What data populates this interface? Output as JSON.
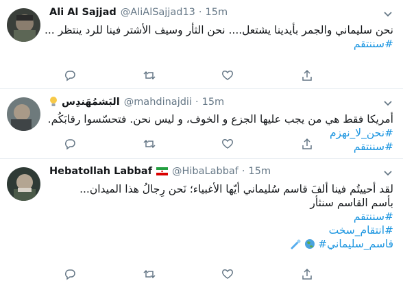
{
  "tweets": [
    {
      "name": "Ali Al Sajjad",
      "handle": "@AliAlSajjad13",
      "separator": "·",
      "time": "15m",
      "lines": [
        "نحن سليماني والجمر بأيدينا يشتعل.... نحن الثأر وسيف الأشتر فينا للرد ينتظر ..."
      ],
      "hashtags": [
        "#سننتقم"
      ]
    },
    {
      "name": "البَشمُهَندِس",
      "handle": "@mahdinajdii",
      "separator": "·",
      "time": "15m",
      "lines": [
        "أمريكا فقط هي من يجب عليها الجزع و الخوف، و ليس نحن. فتحسّسوا رقابَكُم."
      ],
      "hashtags": [
        "#نحن_لا_نهزم",
        "#سننتقم"
      ]
    },
    {
      "name": "Hebatollah Labbaf",
      "handle": "@HibaLabbaf",
      "separator": "·",
      "time": "15m",
      "lines": [
        "لقد أحييتُم فينا ألفَ قاسم سُليماني أيّها الأغبياء؛ نَحن رِجالُ هذا الميدان...",
        "بأسم القاسم سنثأر"
      ],
      "hashtags": [
        "#سننتقم",
        "#انتقام_سخت",
        "#قاسم_سليماني"
      ]
    }
  ],
  "icons": [
    "chevron-down-icon",
    "reply-icon",
    "retweet-icon",
    "like-icon",
    "share-icon",
    "lightbulb-icon",
    "iran-flag-icon",
    "globe-emoji-icon",
    "comet-emoji-icon"
  ],
  "colors": {
    "link": "#1b95e0",
    "muted": "#657786",
    "divider": "#e6ecf0"
  }
}
